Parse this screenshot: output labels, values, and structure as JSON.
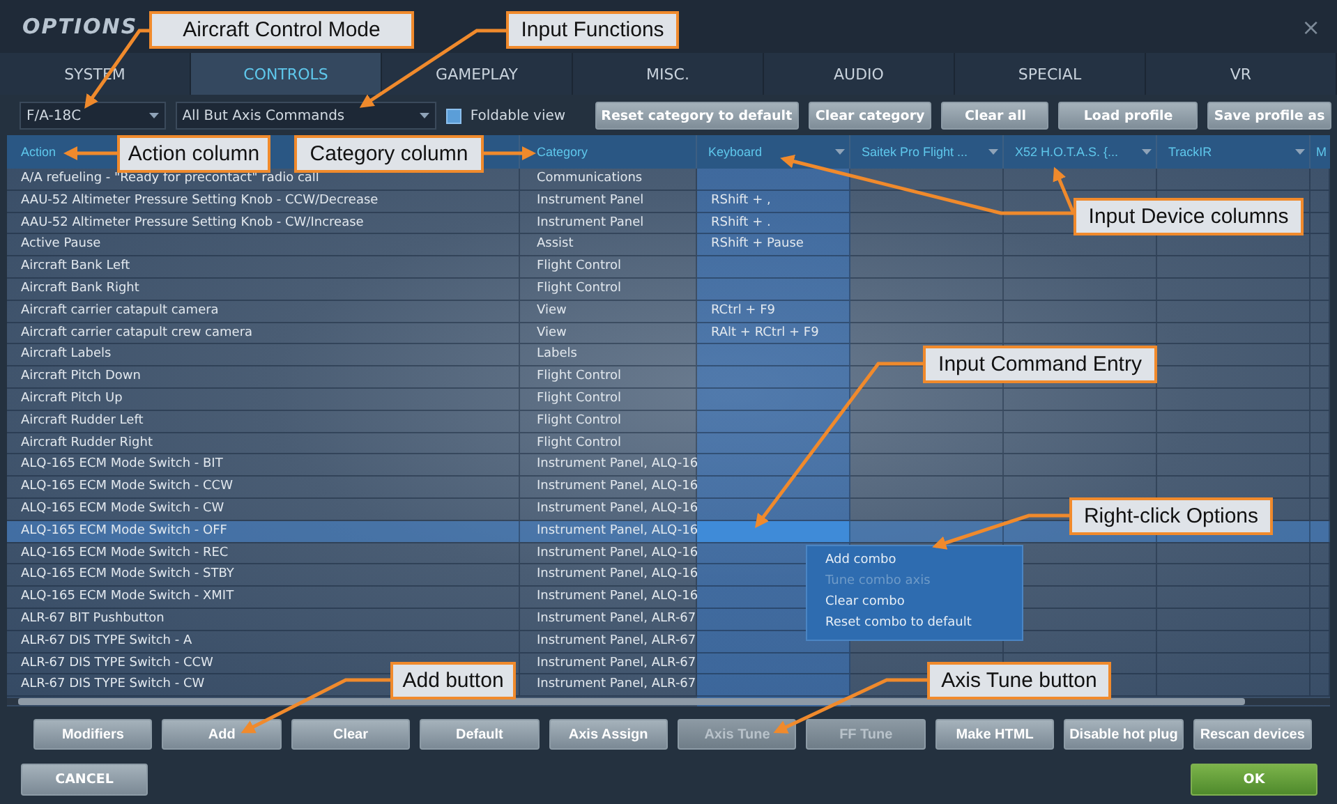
{
  "window": {
    "title": "OPTIONS",
    "close": "×"
  },
  "tabs": [
    {
      "label": "SYSTEM",
      "selected": false
    },
    {
      "label": "CONTROLS",
      "selected": true
    },
    {
      "label": "GAMEPLAY",
      "selected": false
    },
    {
      "label": "MISC.",
      "selected": false
    },
    {
      "label": "AUDIO",
      "selected": false
    },
    {
      "label": "SPECIAL",
      "selected": false
    },
    {
      "label": "VR",
      "selected": false
    }
  ],
  "toolbar": {
    "aircraft": {
      "value": "F/A-18C"
    },
    "functions": {
      "value": "All But Axis Commands"
    },
    "foldable_view": {
      "label": "Foldable view",
      "checked": false
    },
    "buttons": [
      "Reset category to default",
      "Clear category",
      "Clear all",
      "Load profile",
      "Save profile as"
    ]
  },
  "table": {
    "columns": [
      {
        "label": "Action",
        "kind": "plain"
      },
      {
        "label": "Category",
        "kind": "plain"
      },
      {
        "label": "Keyboard",
        "kind": "device"
      },
      {
        "label": "Saitek Pro Flight ...",
        "kind": "device"
      },
      {
        "label": "X52 H.O.T.A.S. {...",
        "kind": "device"
      },
      {
        "label": "TrackIR",
        "kind": "device"
      },
      {
        "label": "M",
        "kind": "plain"
      }
    ],
    "rows": [
      {
        "action": "A/A refueling - \"Ready for precontact\" radio call",
        "category": "Communications",
        "selected": false
      },
      {
        "action": "AAU-52 Altimeter Pressure Setting Knob - CCW/Decrease",
        "category": "Instrument Panel",
        "keyboard": "RShift + ,",
        "selected": false
      },
      {
        "action": "AAU-52 Altimeter Pressure Setting Knob - CW/Increase",
        "category": "Instrument Panel",
        "keyboard": "RShift + .",
        "selected": false
      },
      {
        "action": "Active Pause",
        "category": "Assist",
        "keyboard": "RShift + Pause",
        "selected": false
      },
      {
        "action": "Aircraft Bank Left",
        "category": "Flight Control",
        "selected": false
      },
      {
        "action": "Aircraft Bank Right",
        "category": "Flight Control",
        "selected": false
      },
      {
        "action": "Aircraft carrier catapult camera",
        "category": "View",
        "keyboard": "RCtrl + F9",
        "selected": false
      },
      {
        "action": "Aircraft carrier catapult crew camera",
        "category": "View",
        "keyboard": "RAlt + RCtrl + F9",
        "selected": false
      },
      {
        "action": "Aircraft Labels",
        "category": "Labels",
        "selected": false
      },
      {
        "action": "Aircraft Pitch Down",
        "category": "Flight Control",
        "selected": false
      },
      {
        "action": "Aircraft Pitch Up",
        "category": "Flight Control",
        "selected": false
      },
      {
        "action": "Aircraft Rudder Left",
        "category": "Flight Control",
        "selected": false
      },
      {
        "action": "Aircraft Rudder Right",
        "category": "Flight Control",
        "selected": false
      },
      {
        "action": "ALQ-165 ECM Mode Switch - BIT",
        "category": "Instrument Panel, ALQ-16",
        "selected": false
      },
      {
        "action": "ALQ-165 ECM Mode Switch - CCW",
        "category": "Instrument Panel, ALQ-16",
        "selected": false
      },
      {
        "action": "ALQ-165 ECM Mode Switch - CW",
        "category": "Instrument Panel, ALQ-16",
        "selected": false
      },
      {
        "action": "ALQ-165 ECM Mode Switch - OFF",
        "category": "Instrument Panel, ALQ-16",
        "selected": true
      },
      {
        "action": "ALQ-165 ECM Mode Switch - REC",
        "category": "Instrument Panel, ALQ-16",
        "selected": false
      },
      {
        "action": "ALQ-165 ECM Mode Switch - STBY",
        "category": "Instrument Panel, ALQ-16",
        "selected": false
      },
      {
        "action": "ALQ-165 ECM Mode Switch - XMIT",
        "category": "Instrument Panel, ALQ-16",
        "selected": false
      },
      {
        "action": "ALR-67 BIT Pushbutton",
        "category": "Instrument Panel, ALR-67",
        "selected": false
      },
      {
        "action": "ALR-67 DIS TYPE Switch - A",
        "category": "Instrument Panel, ALR-67",
        "selected": false
      },
      {
        "action": "ALR-67 DIS TYPE Switch - CCW",
        "category": "Instrument Panel, ALR-67",
        "selected": false
      },
      {
        "action": "ALR-67 DIS TYPE Switch - CW",
        "category": "Instrument Panel, ALR-67",
        "selected": false
      }
    ]
  },
  "context_menu": [
    {
      "label": "Add combo",
      "disabled": false
    },
    {
      "label": "Tune combo axis",
      "disabled": true
    },
    {
      "label": "Clear combo",
      "disabled": false
    },
    {
      "label": "Reset combo to default",
      "disabled": false
    }
  ],
  "bottom_buttons": [
    {
      "label": "Modifiers",
      "disabled": false
    },
    {
      "label": "Add",
      "disabled": false
    },
    {
      "label": "Clear",
      "disabled": false
    },
    {
      "label": "Default",
      "disabled": false
    },
    {
      "label": "Axis Assign",
      "disabled": false
    },
    {
      "label": "Axis Tune",
      "disabled": true
    },
    {
      "label": "FF Tune",
      "disabled": true
    },
    {
      "label": "Make HTML",
      "disabled": false
    },
    {
      "label": "Disable hot plug",
      "disabled": false
    },
    {
      "label": "Rescan devices",
      "disabled": false
    }
  ],
  "footer": {
    "cancel": "CANCEL",
    "ok": "OK"
  },
  "annotations": [
    {
      "text": "Aircraft Control Mode"
    },
    {
      "text": "Input Functions"
    },
    {
      "text": "Action column"
    },
    {
      "text": "Category column"
    },
    {
      "text": "Input Device columns"
    },
    {
      "text": "Input Command Entry"
    },
    {
      "text": "Right-click Options"
    },
    {
      "text": "Add button"
    },
    {
      "text": "Axis Tune button"
    }
  ]
}
